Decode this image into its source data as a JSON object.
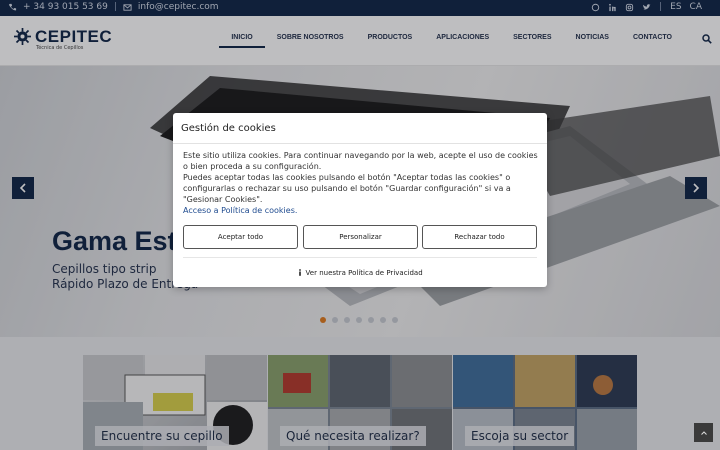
{
  "topbar": {
    "phone": "+ 34 93 015 53 69",
    "separator": "|",
    "email": "info@cepitec.com",
    "languages": [
      "ES",
      "CA"
    ],
    "social": [
      "whatsapp-icon",
      "linkedin-icon",
      "instagram-icon",
      "twitter-icon"
    ]
  },
  "brand": {
    "name": "CEPITEC",
    "tagline": "Técnica de Cepillos"
  },
  "menu": [
    "INICIO",
    "SOBRE NOSOTROS",
    "PRODUCTOS",
    "APLICACIONES",
    "SECTORES",
    "NOTICIAS",
    "CONTACTO"
  ],
  "hero": {
    "title": "Gama Estándar",
    "line1": "Cepillos tipo strip",
    "line2": "Rápido Plazo de Entrega",
    "slides_total": 7,
    "active_slide": 1
  },
  "cookies": {
    "title": "Gestión de cookies",
    "paragraph1": "Este sitio utiliza cookies. Para continuar navegando por la web, acepte el uso de cookies o bien proceda a su configuración.",
    "paragraph2": "Puedes aceptar todas las cookies pulsando el botón \"Aceptar todas las cookies\" o configurarlas o rechazar su uso pulsando el botón \"Guardar configuración\" si va a \"Gesionar Cookies\".",
    "policy_link": "Acceso a Política de cookies.",
    "accept_all": "Aceptar todo",
    "customize": "Personalizar",
    "reject_all": "Rechazar todo",
    "privacy": "Ver nuestra Política de Privacidad"
  },
  "tiles": [
    "Encuentre su cepillo",
    "Qué necesita realizar?",
    "Escoja su sector"
  ],
  "colors": {
    "navy": "#0f2446",
    "accent_dot": "#e07b1c"
  }
}
